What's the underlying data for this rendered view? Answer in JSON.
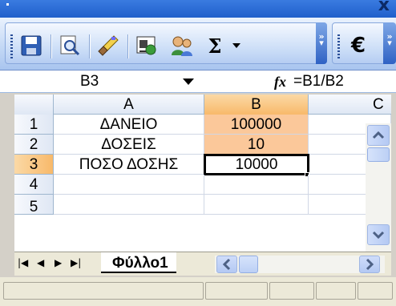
{
  "window": {
    "close_glyph": "x"
  },
  "toolbar": {
    "buttons": [
      {
        "name": "save",
        "icon": "save-icon"
      },
      {
        "name": "print-preview",
        "icon": "print-preview-icon"
      },
      {
        "name": "format-painter",
        "icon": "format-painter-icon"
      },
      {
        "name": "insert-hyperlink",
        "icon": "hyperlink-icon"
      },
      {
        "name": "research",
        "icon": "research-icon"
      },
      {
        "name": "autosum",
        "icon": "sigma-icon",
        "label": "Σ"
      },
      {
        "name": "currency",
        "icon": "euro-icon",
        "label": "€"
      }
    ]
  },
  "formula_bar": {
    "name_box": "B3",
    "fx_label": "fx",
    "formula": "=B1/B2"
  },
  "grid": {
    "columns": [
      "A",
      "B",
      "C"
    ],
    "rows": [
      "1",
      "2",
      "3",
      "4",
      "5"
    ],
    "cells": {
      "A1": "ΔΑΝΕΙΟ",
      "B1": "100000",
      "A2": "ΔΟΣΕΙΣ",
      "B2": "10",
      "A3": "ΠΟΣΟ ΔΟΣΗΣ",
      "B3": "10000"
    },
    "selected_cell": "B3"
  },
  "sheet_tabs": {
    "active": "Φύλλο1"
  },
  "colors": {
    "highlight": "#fbc89a",
    "header_selected": "#f8b96a",
    "toolbar_blue": "#c5d9f5"
  }
}
